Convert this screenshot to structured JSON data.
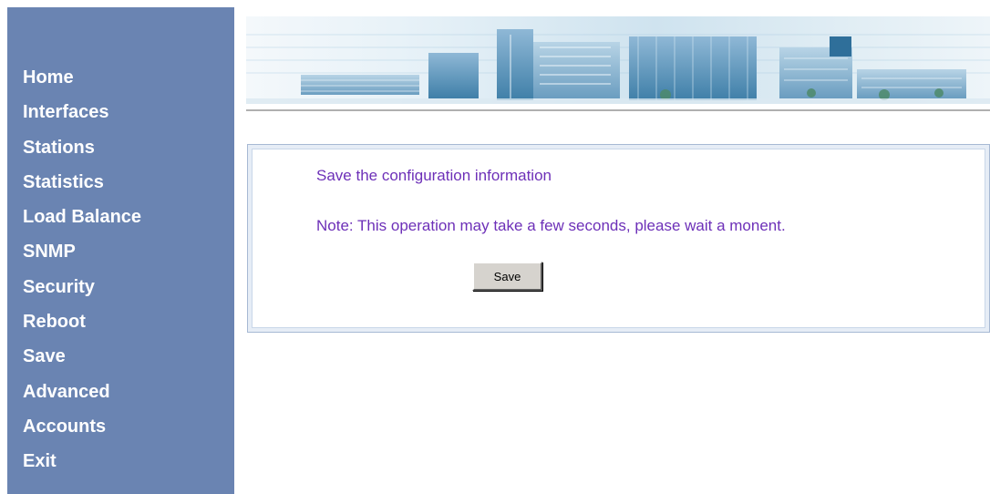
{
  "colors": {
    "sidebar_bg": "#6a84b2",
    "nav_text": "#ffffff",
    "content_text": "#6d30b8",
    "panel_border": "#a7b9d4",
    "button_face": "#d6d3ce"
  },
  "nav": {
    "items": [
      {
        "label": "Home"
      },
      {
        "label": "Interfaces"
      },
      {
        "label": "Stations"
      },
      {
        "label": "Statistics"
      },
      {
        "label": "Load Balance"
      },
      {
        "label": "SNMP"
      },
      {
        "label": "Security"
      },
      {
        "label": "Reboot"
      },
      {
        "label": "Save"
      },
      {
        "label": "Advanced"
      },
      {
        "label": "Accounts"
      },
      {
        "label": "Exit"
      }
    ]
  },
  "banner": {
    "image": "office-buildings-banner"
  },
  "main": {
    "title": "Save the configuration information",
    "note": "Note: This operation may take a few seconds, please wait a monent.",
    "save_button_label": "Save"
  }
}
